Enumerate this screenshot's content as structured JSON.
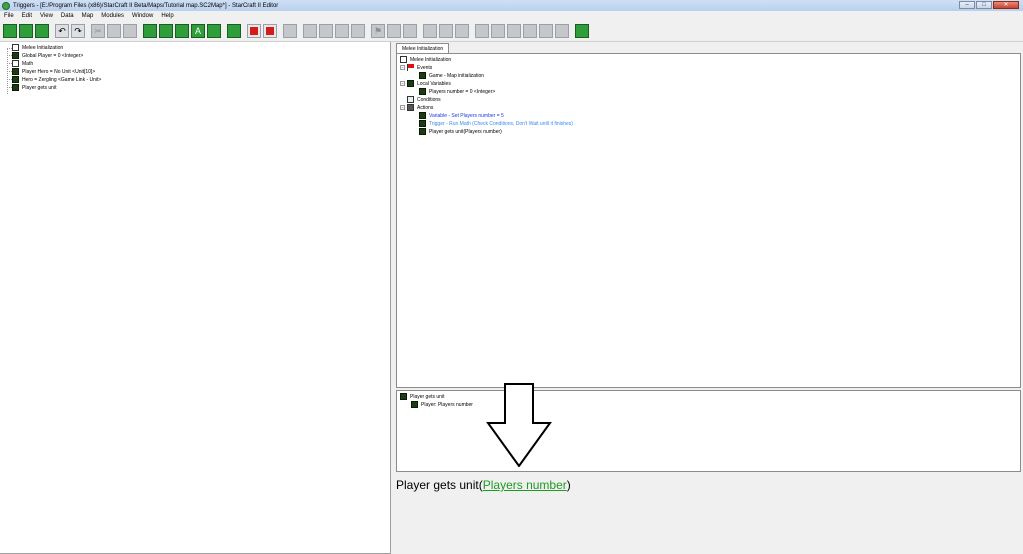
{
  "window": {
    "title": "Triggers - [E:/Program Files (x86)/StarCraft II Beta/Maps/Tutorial map.SC2Map*] - StarCraft II Editor",
    "controls": [
      "–",
      "□",
      "✕"
    ]
  },
  "menu": [
    "File",
    "Edit",
    "View",
    "Data",
    "Map",
    "Modules",
    "Window",
    "Help"
  ],
  "colors": {
    "accent_green": "#1f9a22",
    "action_blue": "#1a3ad6",
    "trigger_blue": "#3a8aee",
    "stop_red": "#d21c1c"
  },
  "left_tree": [
    {
      "label": "Melee Initialization",
      "icon": "document-icon"
    },
    {
      "label": "Global Player = 0 <Integer>",
      "icon": "function-icon"
    },
    {
      "label": "Math",
      "icon": "document-icon"
    },
    {
      "label": "Player Hero = No Unit <Unit[10]>",
      "icon": "function-icon"
    },
    {
      "label": "Hero = Zergling <Game Link - Unit>",
      "icon": "function-icon"
    },
    {
      "label": "Player gets unit",
      "icon": "function-icon"
    }
  ],
  "tab": {
    "label": "Melee Initialization"
  },
  "outline": {
    "root": "Melee Initialization",
    "events": {
      "label": "Events",
      "children": [
        "Game - Map initialization"
      ]
    },
    "local_variables": {
      "label": "Local Variables",
      "children": [
        "Players number = 0 <Integer>"
      ]
    },
    "conditions": {
      "label": "Conditions"
    },
    "actions": {
      "label": "Actions",
      "children": [
        "Variable - Set Players number = 5",
        "Trigger - Run Math  (Check Conditions, Don't Wait until it finishes)",
        "Player gets unit(Players number)"
      ]
    }
  },
  "function_tree": {
    "root": "Player gets unit",
    "param": "Player: Players number"
  },
  "function_summary": {
    "prefix": "Player gets unit(",
    "link": "Players number",
    "suffix": ")"
  }
}
